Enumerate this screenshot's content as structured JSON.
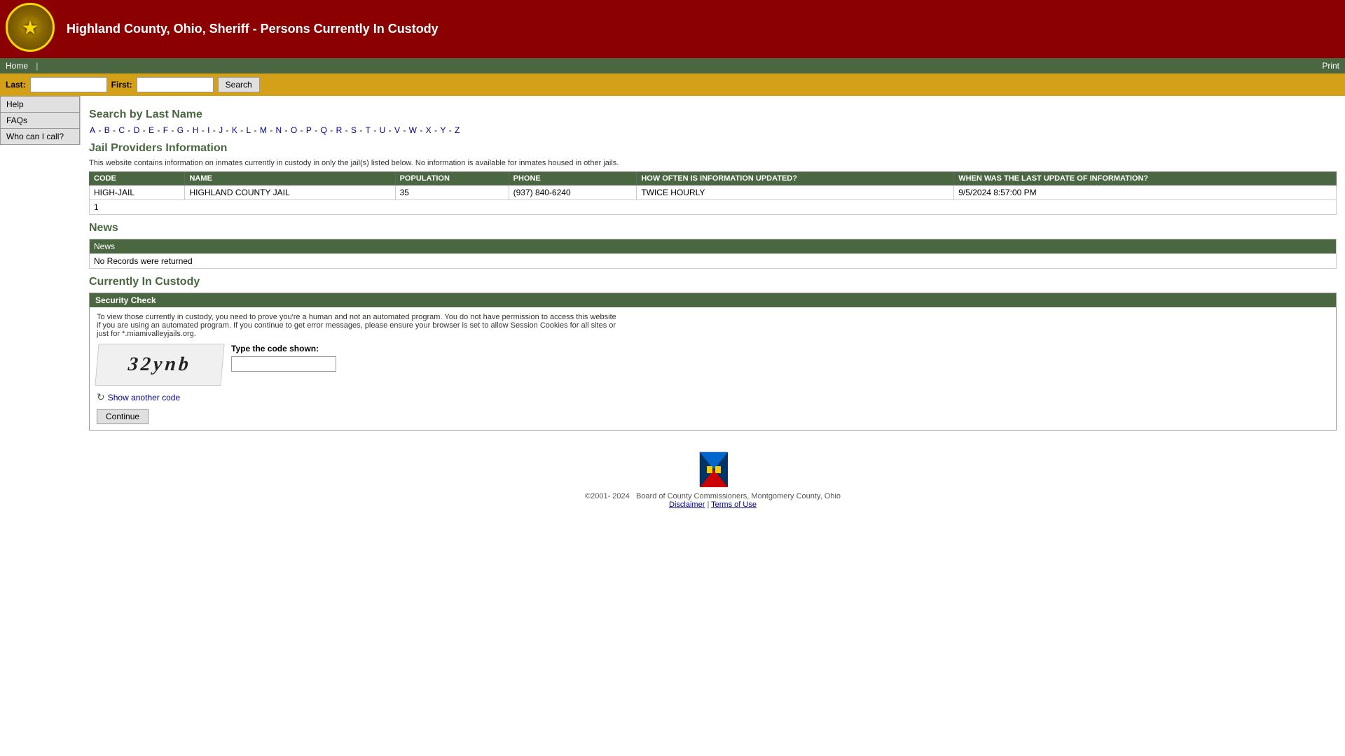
{
  "header": {
    "title": "Highland County, Ohio, Sheriff - Persons Currently In Custody",
    "logo_alt": "Highland County Sheriff Logo"
  },
  "nav": {
    "home_label": "Home",
    "print_label": "Print"
  },
  "searchbar": {
    "last_label": "Last:",
    "first_label": "First:",
    "search_button_label": "Search",
    "last_placeholder": "",
    "first_placeholder": ""
  },
  "sidebar": {
    "help_label": "Help",
    "faqs_label": "FAQs",
    "who_label": "Who can I call?"
  },
  "search_by_last_name": {
    "heading": "Search by Last Name",
    "alphabet": [
      "A",
      "B",
      "C",
      "D",
      "E",
      "F",
      "G",
      "H",
      "I",
      "J",
      "K",
      "L",
      "M",
      "N",
      "O",
      "P",
      "Q",
      "R",
      "S",
      "T",
      "U",
      "V",
      "W",
      "X",
      "Y",
      "Z"
    ]
  },
  "jail_providers": {
    "heading": "Jail Providers Information",
    "note": "This website contains information on inmates currently in custody in only the jail(s) listed below. No information is available for inmates housed in other jails.",
    "table_headers": [
      "CODE",
      "NAME",
      "POPULATION",
      "PHONE",
      "HOW OFTEN IS INFORMATION UPDATED?",
      "WHEN WAS THE LAST UPDATE OF INFORMATION?"
    ],
    "rows": [
      {
        "code": "HIGH-JAIL",
        "name": "HIGHLAND COUNTY JAIL",
        "population": "35",
        "phone": "(937) 840-6240",
        "update_freq": "TWICE HOURLY",
        "last_update": "9/5/2024 8:57:00 PM"
      }
    ],
    "footer_row": "1"
  },
  "news": {
    "heading": "News",
    "header_label": "News",
    "no_records_message": "No Records were returned"
  },
  "currently_in_custody": {
    "heading": "Currently In Custody",
    "security_check": {
      "header_label": "Security Check",
      "note": "To view those currently in custody, you need to prove you're a human and not an automated program. You do not have permission to access this website if you are using an automated program. If you continue to get error messages, please ensure your browser is set to allow Session Cookies for all sites or just for *.miamivalleyjails.org.",
      "captcha_text": "32ynb",
      "type_code_label": "Type the code shown:",
      "show_another_label": "Show another code",
      "continue_button_label": "Continue"
    }
  },
  "footer": {
    "copyright": "©2001- 2024",
    "org_name": "Board of County Commissioners, Montgomery County, Ohio",
    "disclaimer_label": "Disclaimer",
    "terms_label": "Terms of Use",
    "separator": "|"
  }
}
